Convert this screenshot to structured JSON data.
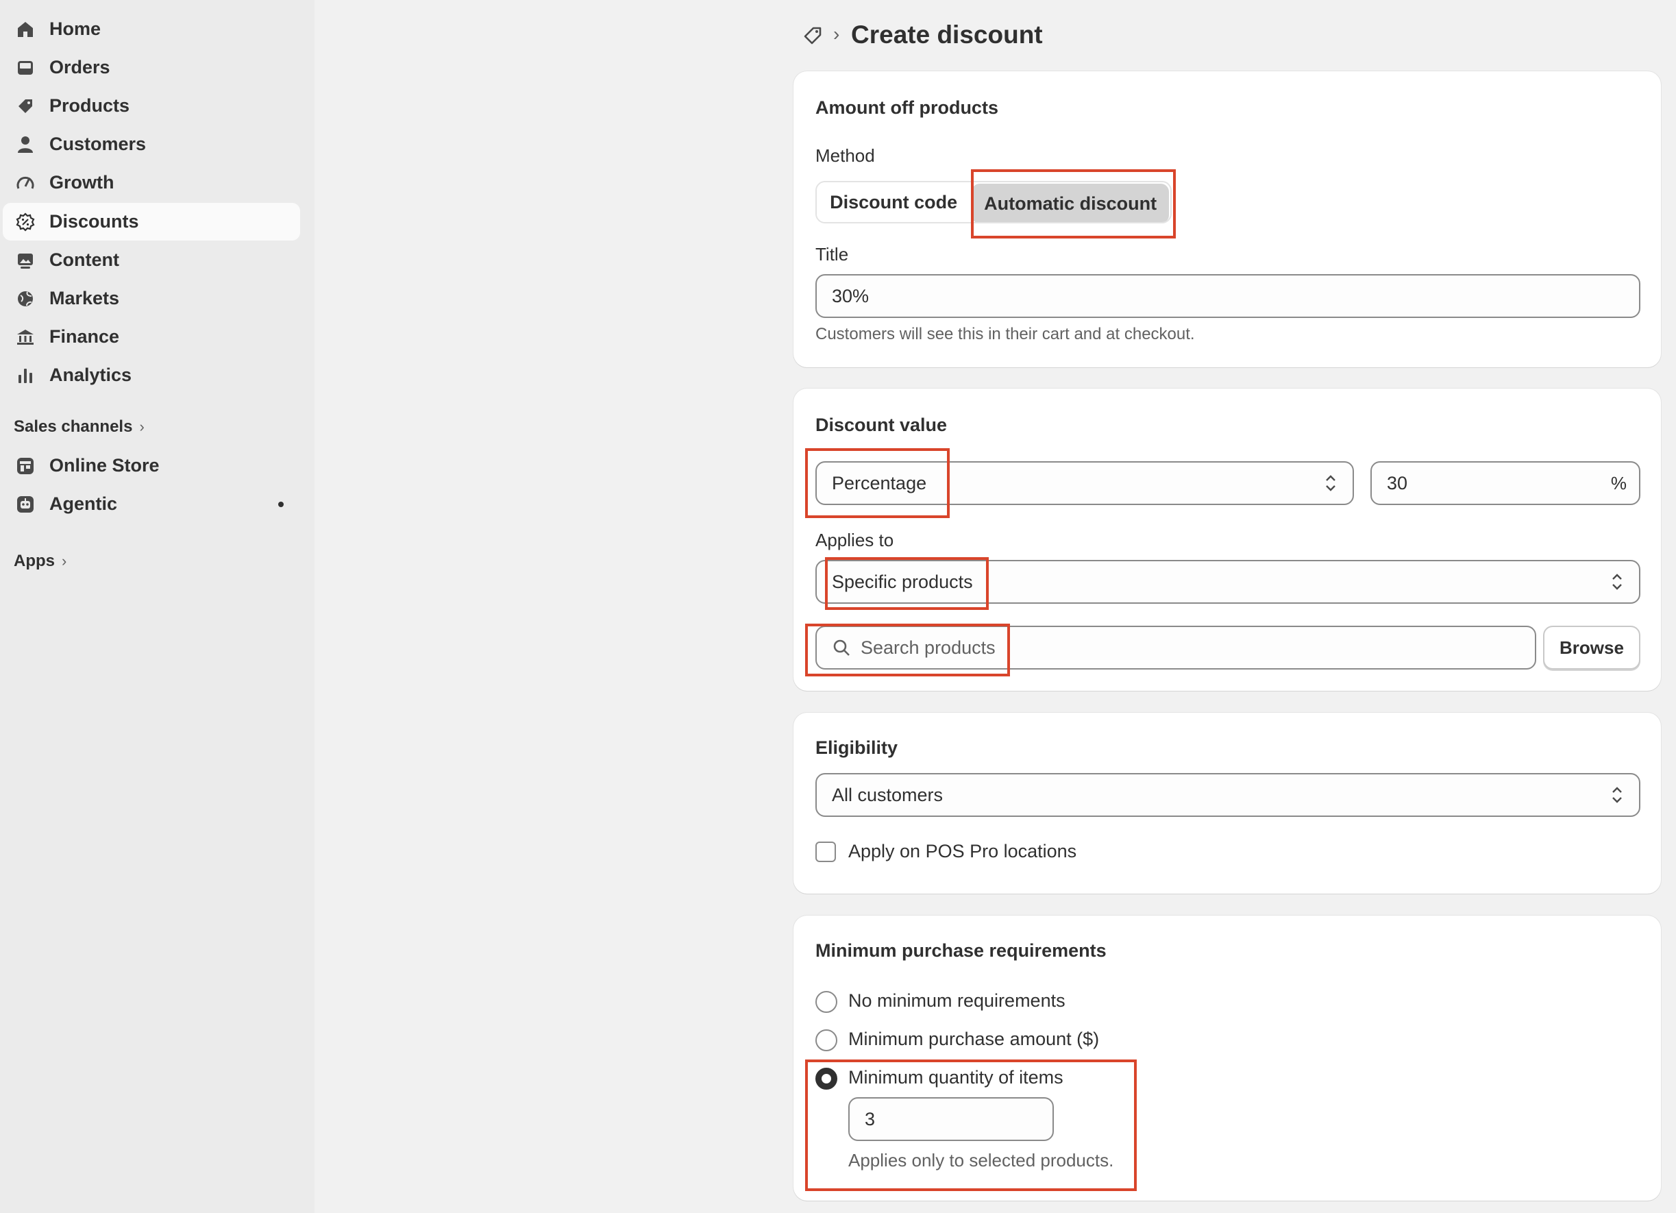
{
  "sidebar": {
    "items": [
      {
        "label": "Home",
        "icon": "home-icon"
      },
      {
        "label": "Orders",
        "icon": "inbox-icon"
      },
      {
        "label": "Products",
        "icon": "tag-icon"
      },
      {
        "label": "Customers",
        "icon": "person-icon"
      },
      {
        "label": "Growth",
        "icon": "gauge-icon"
      },
      {
        "label": "Discounts",
        "icon": "discount-icon"
      },
      {
        "label": "Content",
        "icon": "image-icon"
      },
      {
        "label": "Markets",
        "icon": "globe-icon"
      },
      {
        "label": "Finance",
        "icon": "bank-icon"
      },
      {
        "label": "Analytics",
        "icon": "bar-chart-icon"
      }
    ],
    "active": "Discounts",
    "sales_channels_label": "Sales channels",
    "channels": [
      {
        "label": "Online Store",
        "icon": "store-icon"
      },
      {
        "label": "Agentic",
        "icon": "robot-icon"
      }
    ],
    "apps_label": "Apps"
  },
  "header": {
    "title": "Create discount",
    "icon": "discount-tag-icon"
  },
  "amount_card": {
    "title": "Amount off products",
    "method_label": "Method",
    "method_code": "Discount code",
    "method_auto": "Automatic discount",
    "title_label": "Title",
    "title_value": "30%",
    "title_help": "Customers will see this in their cart and at checkout."
  },
  "value_card": {
    "title": "Discount value",
    "type_value": "Percentage",
    "amount_value": "30",
    "amount_suffix": "%",
    "applies_label": "Applies to",
    "applies_value": "Specific products",
    "search_placeholder": "Search products",
    "browse_label": "Browse"
  },
  "eligibility_card": {
    "title": "Eligibility",
    "value": "All customers",
    "pos_label": "Apply on POS Pro locations"
  },
  "minimum_card": {
    "title": "Minimum purchase requirements",
    "opt_none": "No minimum requirements",
    "opt_amount": "Minimum purchase amount ($)",
    "opt_quantity": "Minimum quantity of items",
    "quantity_value": "3",
    "quantity_help": "Applies only to selected products."
  },
  "colors": {
    "highlight": "#d9452b",
    "selected_segment": "#d4d4d4",
    "active_nav": "#fafafa"
  }
}
